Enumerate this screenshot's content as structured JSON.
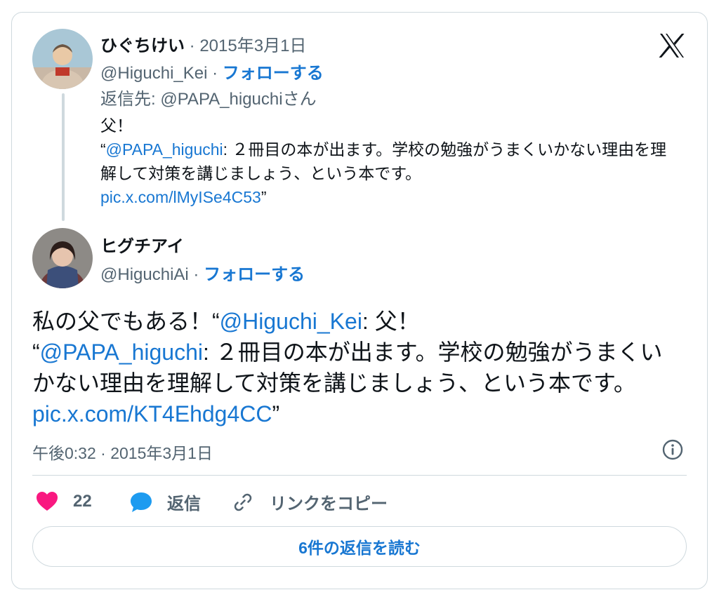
{
  "quoted": {
    "display_name": "ひぐちけい",
    "date": "2015年3月1日",
    "handle": "@Higuchi_Kei",
    "follow_label": "フォローする",
    "reply_to_prefix": "返信先: ",
    "reply_to_handle": "@PAPA_higuchi",
    "reply_to_suffix": "さん",
    "text_line1": "父！",
    "text_open_quote": "“",
    "text_mention": "@PAPA_higuchi",
    "text_body": ": ２冊目の本が出ます。学校の勉強がうまくいかない理由を理解して対策を講じましょう、という本です。",
    "text_link": "pic.x.com/lMyISe4C53",
    "text_close_quote": "”"
  },
  "main": {
    "display_name": "ヒグチアイ",
    "handle": "@HiguchiAi",
    "follow_label": "フォローする",
    "text_intro": "私の父でもある！“",
    "text_mention1": "@Higuchi_Kei",
    "text_part2": ": 父！",
    "text_open_quote2": "“",
    "text_mention2": "@PAPA_higuchi",
    "text_body": ": ２冊目の本が出ます。学校の勉強がうまくいかない理由を理解して対策を講じましょう、という本です。 ",
    "text_link": "pic.x.com/KT4Ehdg4CC",
    "text_close_quote": "”",
    "timestamp": "午後0:32 · 2015年3月1日"
  },
  "separator": " · ",
  "actions": {
    "like_count": "22",
    "reply_label": "返信",
    "copy_link_label": "リンクをコピー"
  },
  "read_replies_label": "6件の返信を読む",
  "icons": {
    "brand": "x-logo-icon",
    "info": "info-icon",
    "like": "heart-icon",
    "reply": "speech-bubble-icon",
    "copy_link": "link-icon"
  },
  "colors": {
    "link": "#1877d2",
    "heart": "#f91880",
    "reply_bubble": "#1d9bf0",
    "muted_text": "#536471",
    "border": "#cfd9de"
  }
}
